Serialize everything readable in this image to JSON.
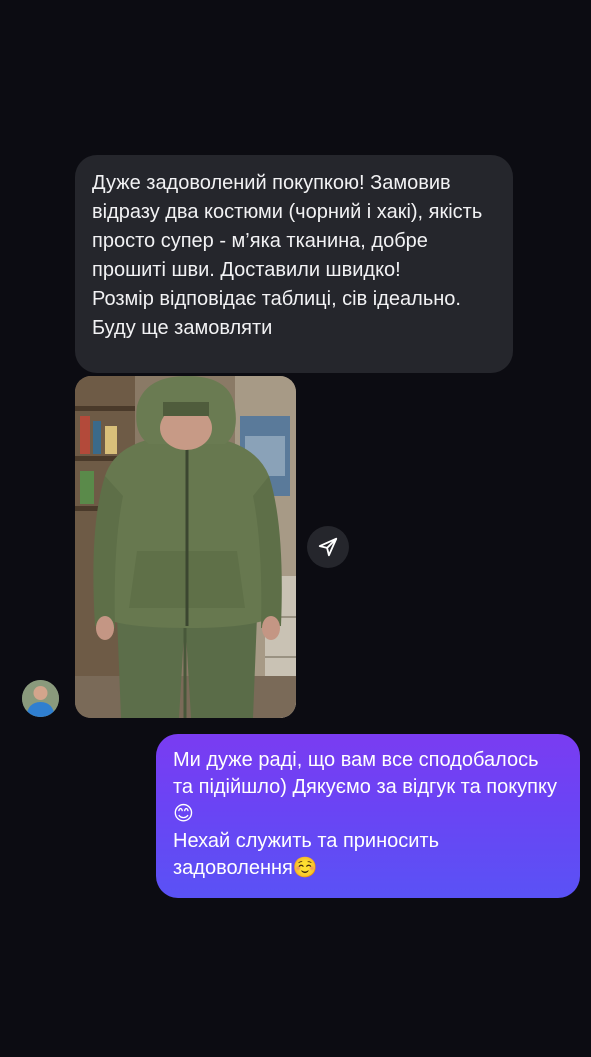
{
  "chat": {
    "incoming_message": {
      "paragraph_1": "Дуже задоволений покупкою! Замовив відразу два костюми (чорний і хакі), якість просто супер - м’яка тканина, добре прошиті шви. Доставили швидко!",
      "paragraph_2": "Розмір відповідає таблиці, сів ідеально. Буду ще замовляти"
    },
    "photo_attachment": {
      "subject": "man wearing khaki hooded fleece tracksuit"
    },
    "outgoing_message": {
      "paragraph_1": "Ми дуже раді, що вам все сподобалось та підійшло) Дякуємо за відгук та покупку😊",
      "paragraph_2": "Нехай служить та приносить задоволення☺️"
    },
    "icons": {
      "share": "paper-plane-icon",
      "avatar": "user-avatar"
    },
    "colors": {
      "background": "#0c0c12",
      "incoming_bubble": "#25262c",
      "outgoing_gradient_top": "#7a3cf2",
      "outgoing_gradient_bottom": "#5a52f5"
    }
  }
}
